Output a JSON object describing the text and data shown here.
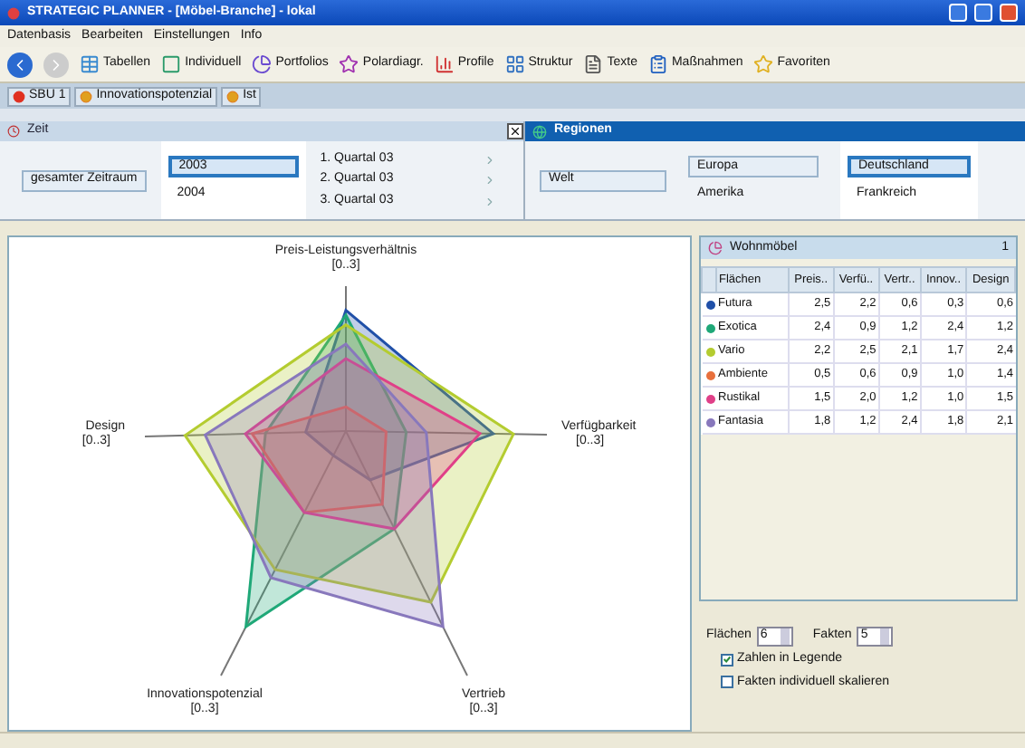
{
  "window": {
    "title": "STRATEGIC PLANNER - [Möbel-Branche] - lokal"
  },
  "menu": [
    "Datenbasis",
    "Bearbeiten",
    "Einstellungen",
    "Info"
  ],
  "toolbar": [
    {
      "label": "Tabellen"
    },
    {
      "label": "Individuell"
    },
    {
      "label": "Portfolios"
    },
    {
      "label": "Polardiagr."
    },
    {
      "label": "Profile"
    },
    {
      "label": "Struktur"
    },
    {
      "label": "Texte"
    },
    {
      "label": "Maßnahmen"
    },
    {
      "label": "Favoriten"
    }
  ],
  "tabs": [
    {
      "label": "SBU 1"
    },
    {
      "label": "Innovationspotenzial"
    },
    {
      "label": "Ist"
    }
  ],
  "zeit": {
    "title": "Zeit",
    "root": {
      "label": "gesamter Zeitraum",
      "boxed": true,
      "selected": false
    },
    "years": [
      {
        "label": "2003",
        "boxed": true,
        "selected": true
      },
      {
        "label": "2004",
        "boxed": false,
        "selected": false
      }
    ],
    "quarters": [
      {
        "label": "1. Quartal 03"
      },
      {
        "label": "2. Quartal 03"
      },
      {
        "label": "3. Quartal 03"
      }
    ]
  },
  "regionen": {
    "title": "Regionen",
    "root": {
      "label": "Welt",
      "boxed": true,
      "selected": false
    },
    "continents": [
      {
        "label": "Europa",
        "boxed": true,
        "selected": false
      },
      {
        "label": "Amerika",
        "boxed": false,
        "selected": false
      }
    ],
    "countries": [
      {
        "label": "Deutschland",
        "boxed": true,
        "selected": true
      },
      {
        "label": "Frankreich",
        "boxed": false,
        "selected": false
      }
    ]
  },
  "chart": {
    "axes": [
      {
        "label": "Preis-Leistungsverhältnis",
        "range": "[0..3]"
      },
      {
        "label": "Design",
        "range": "[0..3]"
      },
      {
        "label": "Verfügbarkeit",
        "range": "[0..3]"
      },
      {
        "label": "Innovationspotenzial",
        "range": "[0..3]"
      },
      {
        "label": "Vertrieb",
        "range": "[0..3]"
      }
    ]
  },
  "table": {
    "title": "Wohnmöbel",
    "count": "1",
    "columns": [
      "Flächen",
      "Preis..",
      "Verfü..",
      "Vertr..",
      "Innov..",
      "Design"
    ],
    "rows": [
      {
        "name": "Futura",
        "color": "#2050a8",
        "values": [
          "2,5",
          "2,2",
          "0,6",
          "0,3",
          "0,6"
        ]
      },
      {
        "name": "Exotica",
        "color": "#1fa878",
        "values": [
          "2,4",
          "0,9",
          "1,2",
          "2,4",
          "1,2"
        ]
      },
      {
        "name": "Vario",
        "color": "#b4cc30",
        "values": [
          "2,2",
          "2,5",
          "2,1",
          "1,7",
          "2,4"
        ]
      },
      {
        "name": "Ambiente",
        "color": "#e8703c",
        "values": [
          "0,5",
          "0,6",
          "0,9",
          "1,0",
          "1,4"
        ]
      },
      {
        "name": "Rustikal",
        "color": "#e04088",
        "values": [
          "1,5",
          "2,0",
          "1,2",
          "1,0",
          "1,5"
        ]
      },
      {
        "name": "Fantasia",
        "color": "#8878bc",
        "values": [
          "1,8",
          "1,2",
          "2,4",
          "1,8",
          "2,1"
        ]
      }
    ]
  },
  "controls": {
    "flaechen": {
      "label": "Flächen",
      "value": "6"
    },
    "fakten": {
      "label": "Fakten",
      "value": "5"
    },
    "checkboxes": [
      {
        "label": "Zahlen in Legende",
        "checked": true
      },
      {
        "label": "Fakten individuell skalieren",
        "checked": false
      }
    ]
  }
}
